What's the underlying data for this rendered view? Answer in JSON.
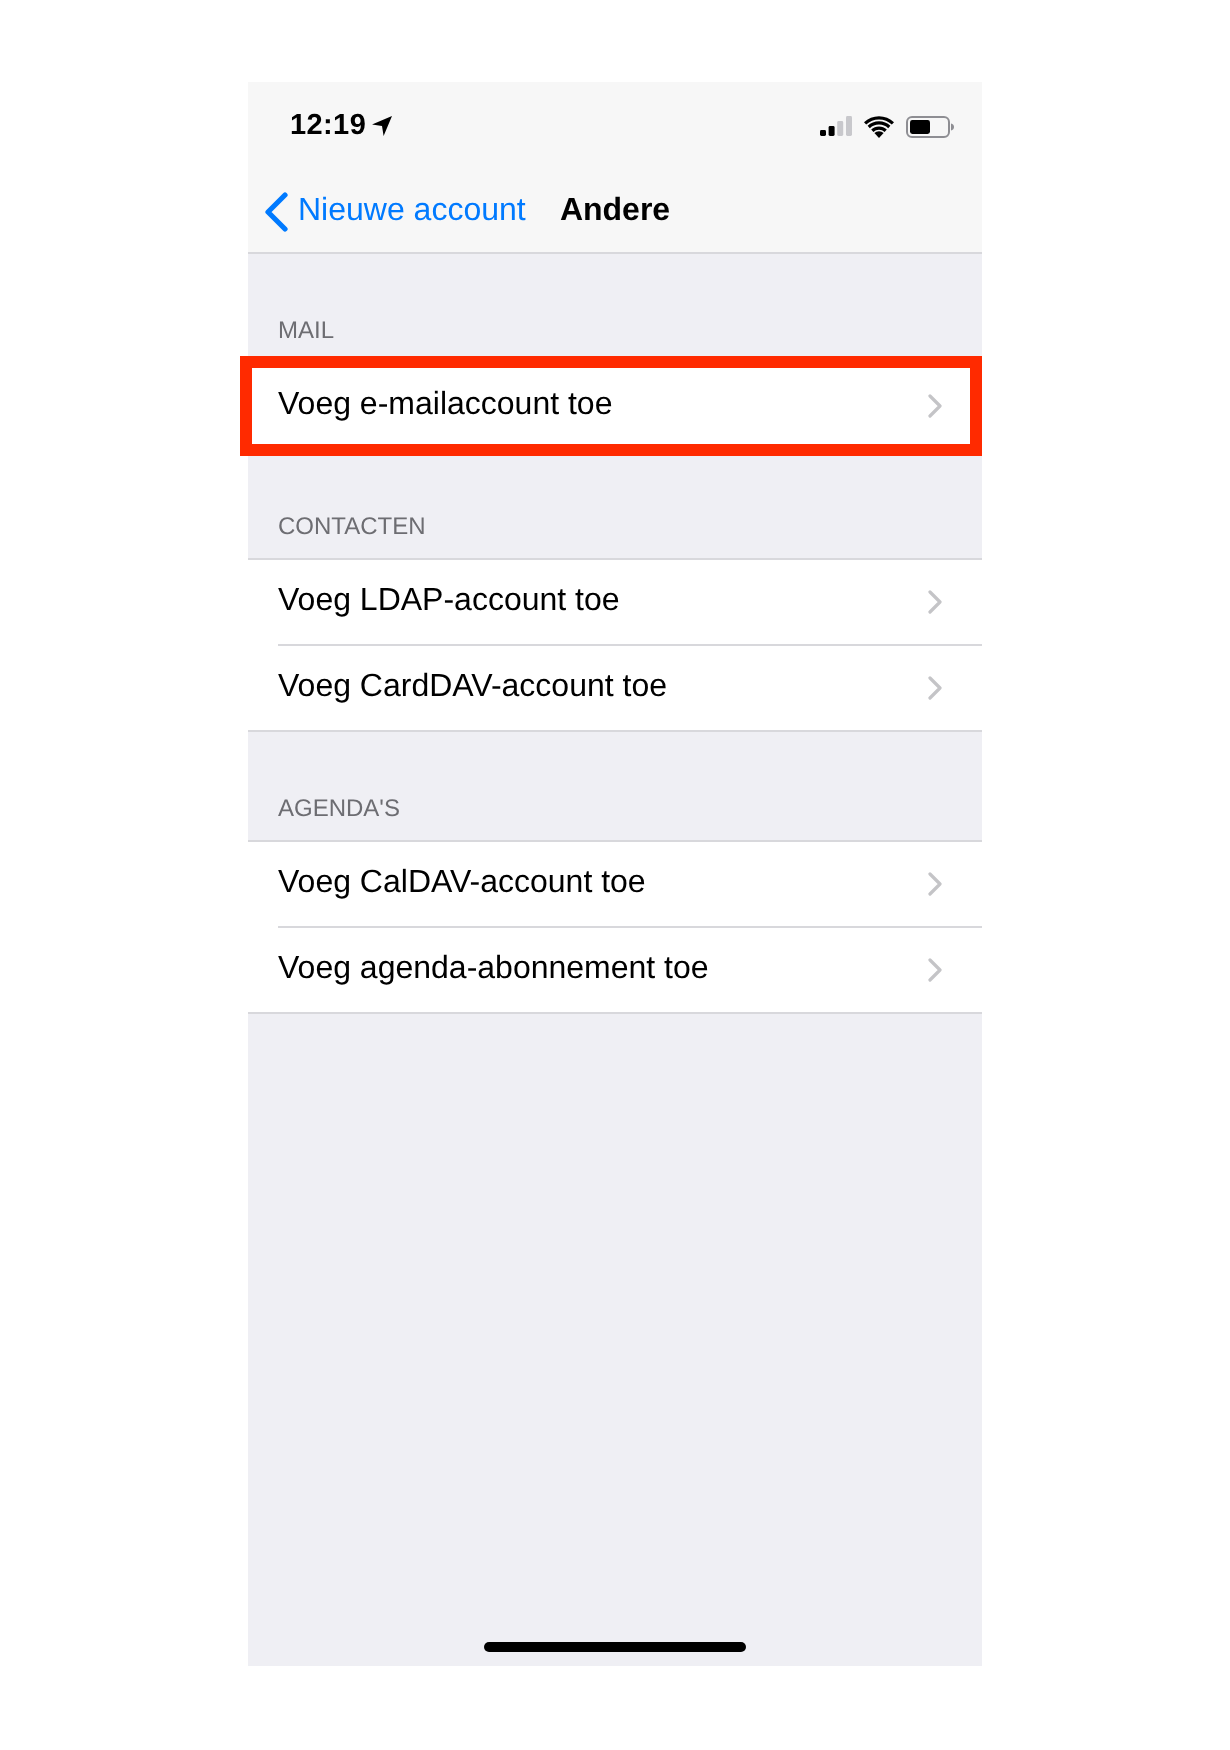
{
  "status_bar": {
    "time": "12:19"
  },
  "nav_bar": {
    "back": "Nieuwe account",
    "title": "Andere"
  },
  "sections": [
    {
      "header": "MAIL",
      "items": [
        {
          "label": "Voeg e-mailaccount toe",
          "highlighted": true
        }
      ]
    },
    {
      "header": "CONTACTEN",
      "items": [
        {
          "label": "Voeg LDAP-account toe",
          "highlighted": false
        },
        {
          "label": "Voeg CardDAV-account toe",
          "highlighted": false
        }
      ]
    },
    {
      "header": "AGENDA'S",
      "items": [
        {
          "label": "Voeg CalDAV-account toe",
          "highlighted": false
        },
        {
          "label": "Voeg agenda-abonnement toe",
          "highlighted": false
        }
      ]
    }
  ]
}
